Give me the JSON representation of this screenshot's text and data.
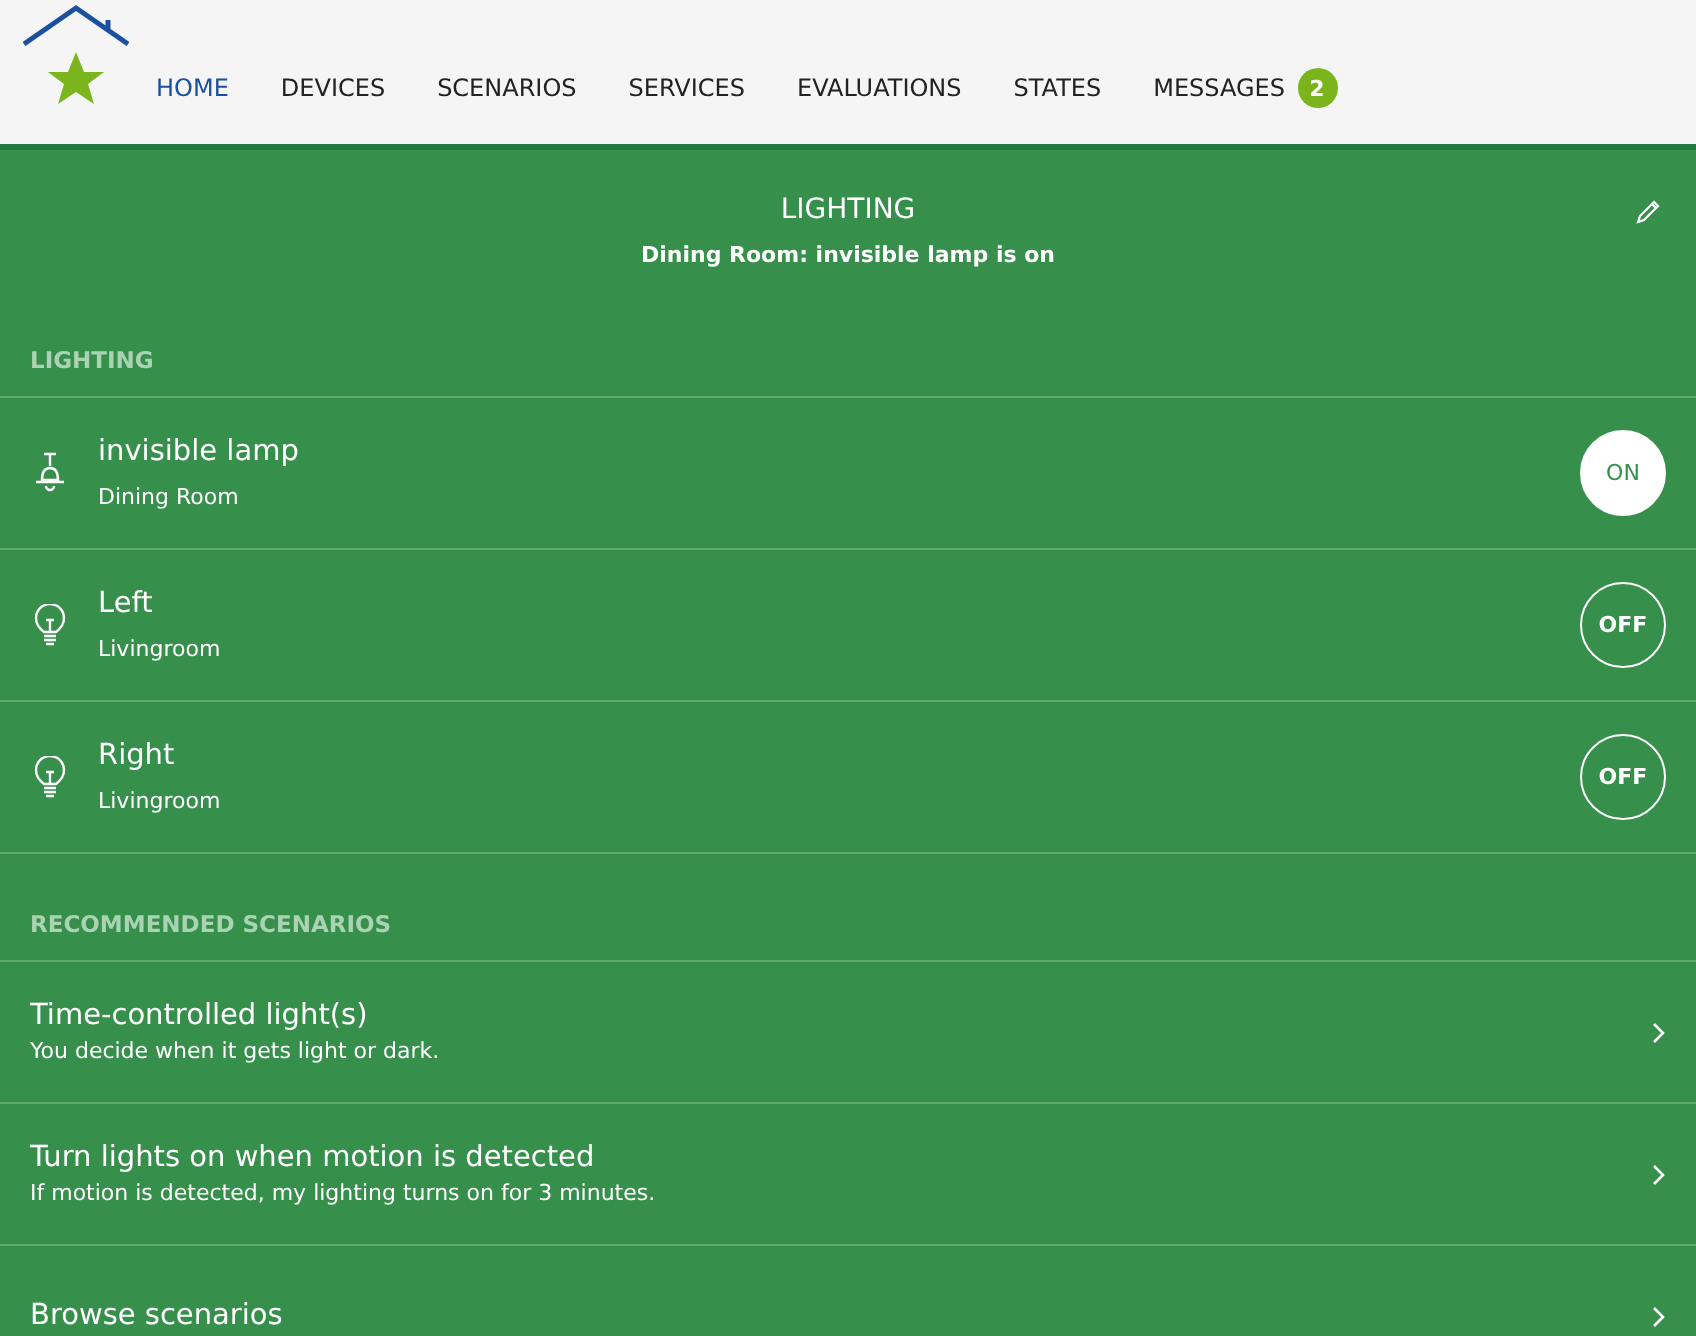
{
  "nav": {
    "items": [
      {
        "label": "HOME",
        "selected": true
      },
      {
        "label": "DEVICES",
        "selected": false
      },
      {
        "label": "SCENARIOS",
        "selected": false
      },
      {
        "label": "SERVICES",
        "selected": false
      },
      {
        "label": "EVALUATIONS",
        "selected": false
      },
      {
        "label": "STATES",
        "selected": false
      },
      {
        "label": "MESSAGES",
        "selected": false,
        "badge": "2"
      }
    ]
  },
  "header": {
    "title": "LIGHTING",
    "subtitle": "Dining Room: invisible lamp is on"
  },
  "devices_section": {
    "title": "LIGHTING",
    "devices": [
      {
        "name": "invisible lamp",
        "room": "Dining Room",
        "kind": "pendant",
        "on": true,
        "toggle": "ON"
      },
      {
        "name": "Left",
        "room": "Livingroom",
        "kind": "bulb",
        "on": false,
        "toggle": "OFF"
      },
      {
        "name": "Right",
        "room": "Livingroom",
        "kind": "bulb",
        "on": false,
        "toggle": "OFF"
      }
    ]
  },
  "scenarios_section": {
    "title": "RECOMMENDED SCENARIOS",
    "items": [
      {
        "title": "Time-controlled light(s)",
        "description": "You decide when it gets light or dark."
      },
      {
        "title": "Turn lights on when motion is detected",
        "description": "If motion is detected, my lighting turns on for 3 minutes."
      },
      {
        "title": "Browse scenarios"
      }
    ]
  }
}
